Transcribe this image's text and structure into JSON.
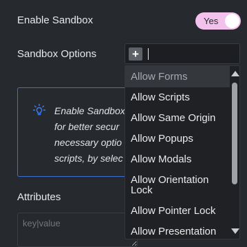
{
  "enable_sandbox": {
    "label": "Enable Sandbox",
    "toggle_label": "Yes",
    "toggle_on": true
  },
  "sandbox_options": {
    "label": "Sandbox Options",
    "add_symbol": "+",
    "dropdown": {
      "items": [
        "Allow Forms",
        "Allow Scripts",
        "Allow Same Origin",
        "Allow Popups",
        "Allow Modals",
        "Allow Orientation Lock",
        "Allow Pointer Lock",
        "Allow Presentation"
      ],
      "highlighted_index": 0
    }
  },
  "info": {
    "lines": [
      "Enable Sandbox",
      "for better secur",
      "necessary optio",
      "scripts, by selec"
    ]
  },
  "attributes": {
    "label": "Attributes",
    "placeholder": "key|value"
  },
  "colors": {
    "toggle_bg": "#f2c1ec",
    "info_border": "#3f6fd1",
    "info_icon": "#3f7de8"
  }
}
